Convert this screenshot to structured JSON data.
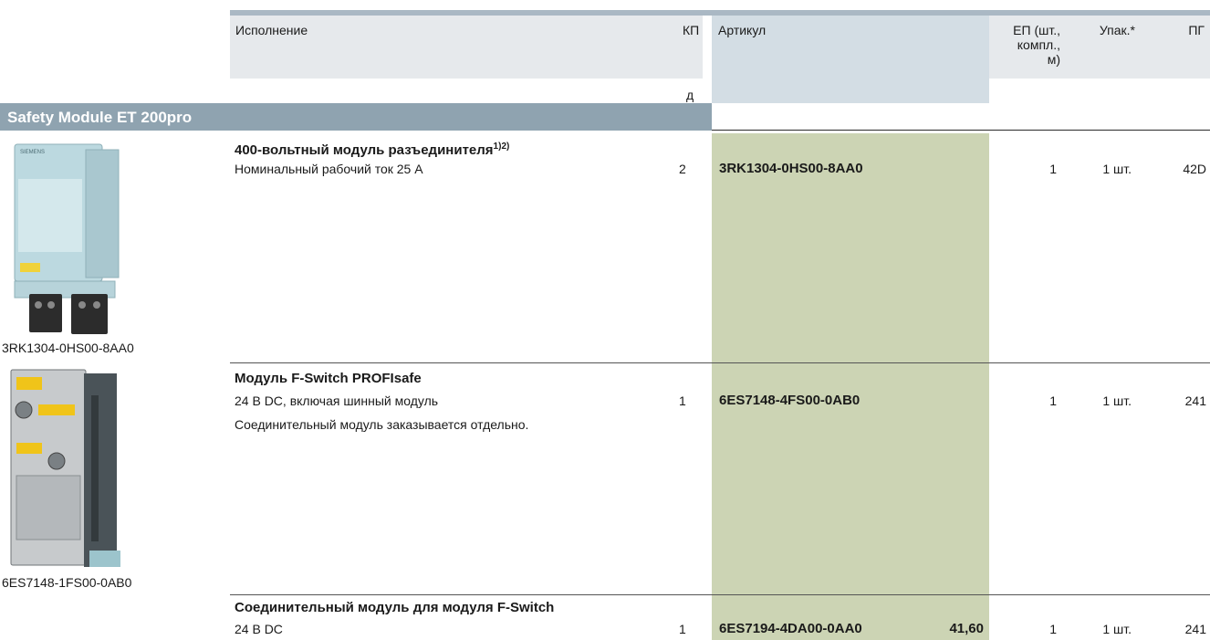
{
  "header": {
    "col_design": "Исполнение",
    "col_kp": "КП",
    "col_kp_sub": "д",
    "col_article": "Артикул",
    "col_unit_lines": [
      "ЕП (шт.,",
      "компл.,",
      "м)"
    ],
    "col_pack": "Упак.*",
    "col_pg": "ПГ"
  },
  "section": {
    "title": "Safety Module ET 200pro"
  },
  "products": [
    {
      "image_caption": "3RK1304-0HS00-8AA0",
      "title": "400-вольтный модуль разъединителя",
      "title_sup": "1)2)",
      "lines": [
        "Номинальный рабочий ток 25 А"
      ],
      "kp": "2",
      "article": "3RK1304-0HS00-8AA0",
      "price": "",
      "unit": "1",
      "pack": "1 шт.",
      "pg": "42D"
    },
    {
      "image_caption": "6ES7148-1FS00-0AB0",
      "title": "Модуль F-Switch PROFIsafe",
      "title_sup": "",
      "lines": [
        "24 В DC, включая шинный модуль",
        "Соединительный модуль заказывается отдельно."
      ],
      "kp": "1",
      "article": "6ES7148-4FS00-0AB0",
      "price": "",
      "unit": "1",
      "pack": "1 шт.",
      "pg": "241"
    },
    {
      "image_caption": "",
      "title": "Соединительный модуль для модуля F-Switch",
      "title_sup": "",
      "lines": [
        "24 В DC"
      ],
      "kp": "1",
      "article": "6ES7194-4DA00-0AA0",
      "price": "41,60",
      "unit": "1",
      "pack": "1 шт.",
      "pg": "241"
    }
  ],
  "brand": {
    "logo_text": "SIEMENS"
  },
  "colors": {
    "header_band": "#e6e9ec",
    "article_header": "#d3dde4",
    "article_column": "#ccd4b4",
    "section_bar": "#8fa3b0"
  }
}
